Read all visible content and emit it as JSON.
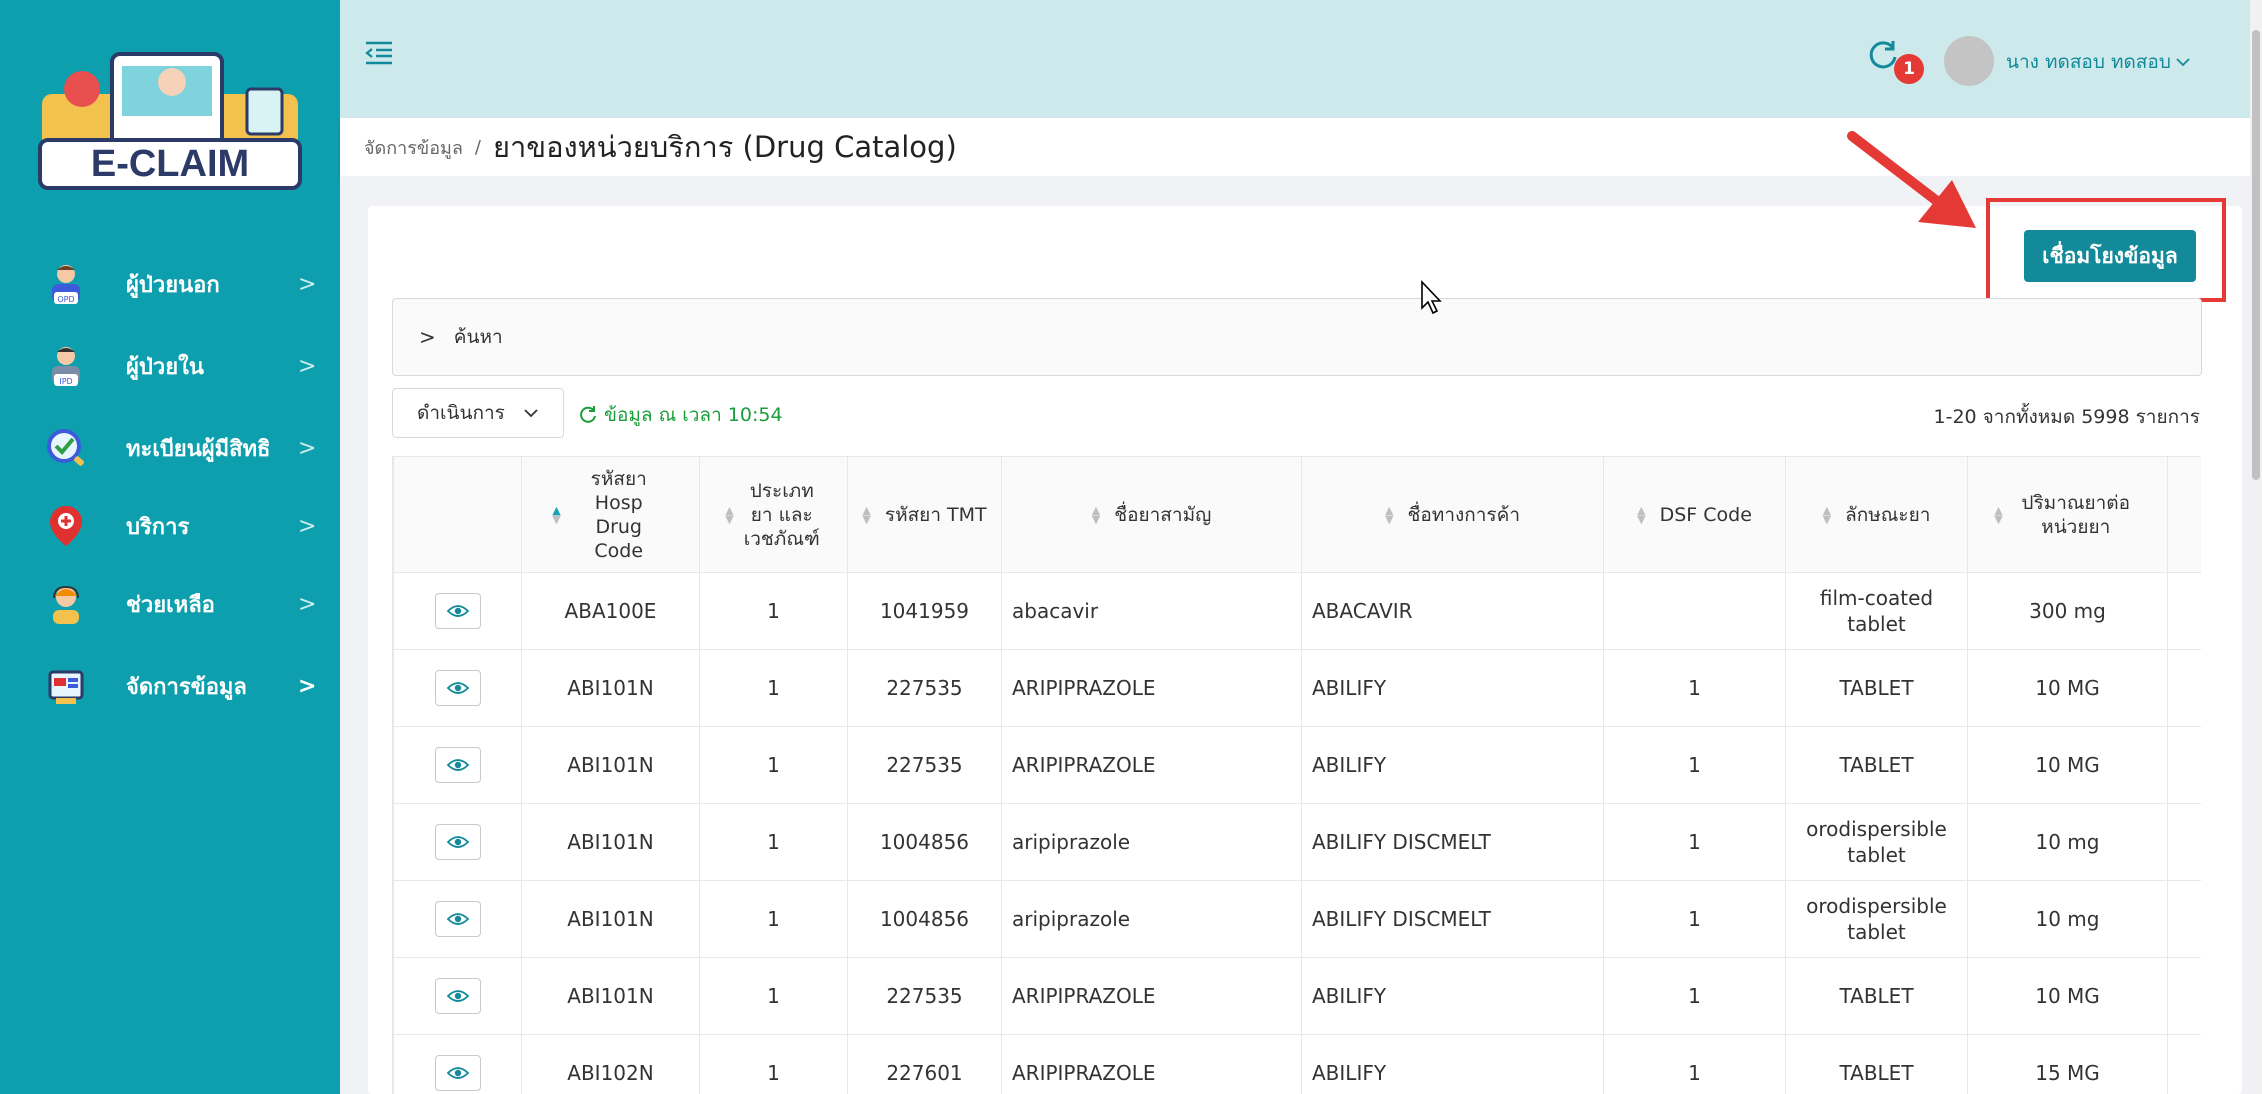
{
  "app": {
    "logo_text": "E-CLAIM"
  },
  "sidebar": {
    "items": [
      {
        "label": "ผู้ป่วยนอก",
        "icon": "opd-patient-icon",
        "badge": "OPD"
      },
      {
        "label": "ผู้ป่วยใน",
        "icon": "ipd-patient-icon",
        "badge": "IPD"
      },
      {
        "label": "ทะเบียนผู้มีสิทธิ",
        "icon": "registry-check-icon"
      },
      {
        "label": "บริการ",
        "icon": "location-pin-icon"
      },
      {
        "label": "ช่วยเหลือ",
        "icon": "support-agent-icon"
      },
      {
        "label": "จัดการข้อมูล",
        "icon": "data-management-icon"
      }
    ],
    "chevron": ">"
  },
  "header": {
    "notification_count": "1",
    "user_name": "นาง ทดสอบ ทดสอบ"
  },
  "breadcrumb": {
    "parent": "จัดการข้อมูล",
    "separator": "/",
    "current": "ยาของหน่วยบริการ (Drug Catalog)"
  },
  "toolbar": {
    "link_button": "เชื่อมโยงข้อมูล",
    "search_label": "ค้นหา",
    "search_chevron": ">",
    "actions_label": "ดำเนินการ",
    "refresh_text": "ข้อมูล ณ เวลา 10:54",
    "pagination_summary": "1-20 จากทั้งหมด 5998 รายการ"
  },
  "table": {
    "columns": [
      "",
      "รหัสยา Hosp Drug Code",
      "ประเภทยา และ เวชภัณฑ์",
      "รหัสยา TMT",
      "ชื่อยาสามัญ",
      "ชื่อทางการค้า",
      "DSF Code",
      "ลักษณะยา",
      "ปริมาณยาต่อ หน่วยยา"
    ],
    "rows": [
      [
        "ABA100E",
        "1",
        "1041959",
        "abacavir",
        "ABACAVIR",
        "",
        "film-coated tablet",
        "300 mg"
      ],
      [
        "ABI101N",
        "1",
        "227535",
        "ARIPIPRAZOLE",
        "ABILIFY",
        "1",
        "TABLET",
        "10 MG"
      ],
      [
        "ABI101N",
        "1",
        "227535",
        "ARIPIPRAZOLE",
        "ABILIFY",
        "1",
        "TABLET",
        "10 MG"
      ],
      [
        "ABI101N",
        "1",
        "1004856",
        "aripiprazole",
        "ABILIFY DISCMELT",
        "1",
        "orodispersible tablet",
        "10 mg"
      ],
      [
        "ABI101N",
        "1",
        "1004856",
        "aripiprazole",
        "ABILIFY DISCMELT",
        "1",
        "orodispersible tablet",
        "10 mg"
      ],
      [
        "ABI101N",
        "1",
        "227535",
        "ARIPIPRAZOLE",
        "ABILIFY",
        "1",
        "TABLET",
        "10 MG"
      ],
      [
        "ABI102N",
        "1",
        "227601",
        "ARIPIPRAZOLE",
        "ABILIFY",
        "1",
        "TABLET",
        "15 MG"
      ]
    ]
  },
  "colors": {
    "sidebar": "#0d9fad",
    "topbar": "#cde9ec",
    "primary": "#128a9a",
    "annotation": "#e53935",
    "notification": "#e53935"
  }
}
